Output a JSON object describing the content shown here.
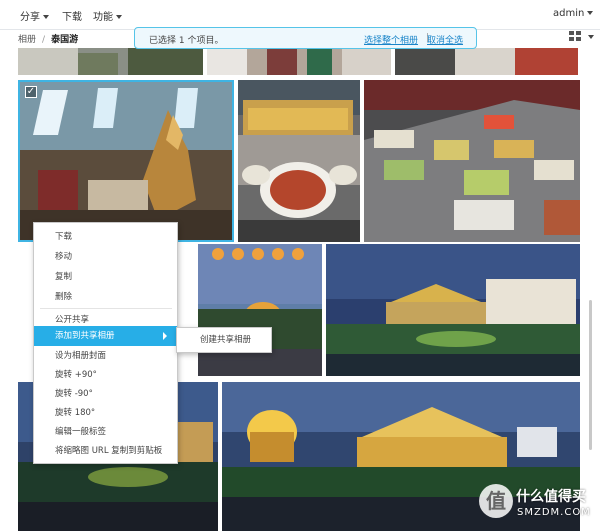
{
  "toolbar": {
    "share_label": "分享",
    "download_label": "下载",
    "features_label": "功能",
    "user_label": "admin"
  },
  "breadcrumb": {
    "root": "相册",
    "separator": "/",
    "current": "泰国游"
  },
  "selection_bar": {
    "status_text": "已选择 1 个项目。",
    "select_album_link": "选择整个相册",
    "divider": "|",
    "deselect_link": "取消全选"
  },
  "photos": [
    {
      "name": "top-strip-left"
    },
    {
      "name": "top-strip-mid"
    },
    {
      "name": "top-strip-right"
    },
    {
      "name": "temple-buffet-hall",
      "selected": true
    },
    {
      "name": "curry-trays"
    },
    {
      "name": "buffet-counter"
    },
    {
      "name": "lantern-night"
    },
    {
      "name": "palace-dusk"
    },
    {
      "name": "bottom-left"
    },
    {
      "name": "illuminated-palace"
    }
  ],
  "context_menu": {
    "items": [
      {
        "label": "下载"
      },
      {
        "label": "移动"
      },
      {
        "label": "复制"
      },
      {
        "label": "删除"
      },
      {
        "label": "公开共享"
      },
      {
        "label": "添加到共享相册",
        "active": true
      },
      {
        "label": "设为相册封面"
      },
      {
        "label": "旋转 +90°"
      },
      {
        "label": "旋转 -90°"
      },
      {
        "label": "旋转 180°"
      },
      {
        "label": "编辑一般标签"
      },
      {
        "label": "将缩略图 URL 复制到剪贴板"
      }
    ],
    "submenu_label": "创建共享相册"
  },
  "watermark": {
    "logo_text": "值",
    "cn": "什么值得买",
    "en": "SMZDM.COM"
  },
  "colors": {
    "accent": "#27aee7",
    "selection_border": "#56c4e8",
    "link": "#1a85c9"
  }
}
